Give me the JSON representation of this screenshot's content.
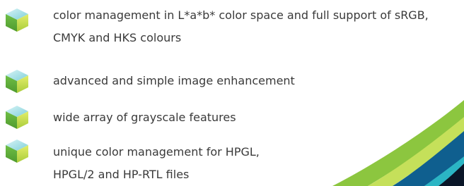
{
  "features": [
    {
      "icon": "cube-icon",
      "lines": [
        "color management in L*a*b* color space and full support of sRGB,",
        "CMYK and HKS colours"
      ]
    },
    {
      "icon": "cube-icon",
      "lines": [
        "advanced and simple image enhancement"
      ]
    },
    {
      "icon": "cube-icon",
      "lines": [
        "wide array of grayscale features"
      ]
    },
    {
      "icon": "cube-icon",
      "lines": [
        "unique color management for HPGL,",
        "HPGL/2 and HP-RTL files"
      ]
    }
  ],
  "colors": {
    "text": "#3a3a3a",
    "cube_top": "#9fdde4",
    "cube_left": "#8cc63f",
    "cube_right": "#c5df3f",
    "swoosh_green": "#8cc63f",
    "swoosh_lime": "#c5e05a",
    "swoosh_teal": "#2bb5c4",
    "swoosh_blue": "#0f5f8f",
    "swoosh_dark": "#0a1628"
  }
}
